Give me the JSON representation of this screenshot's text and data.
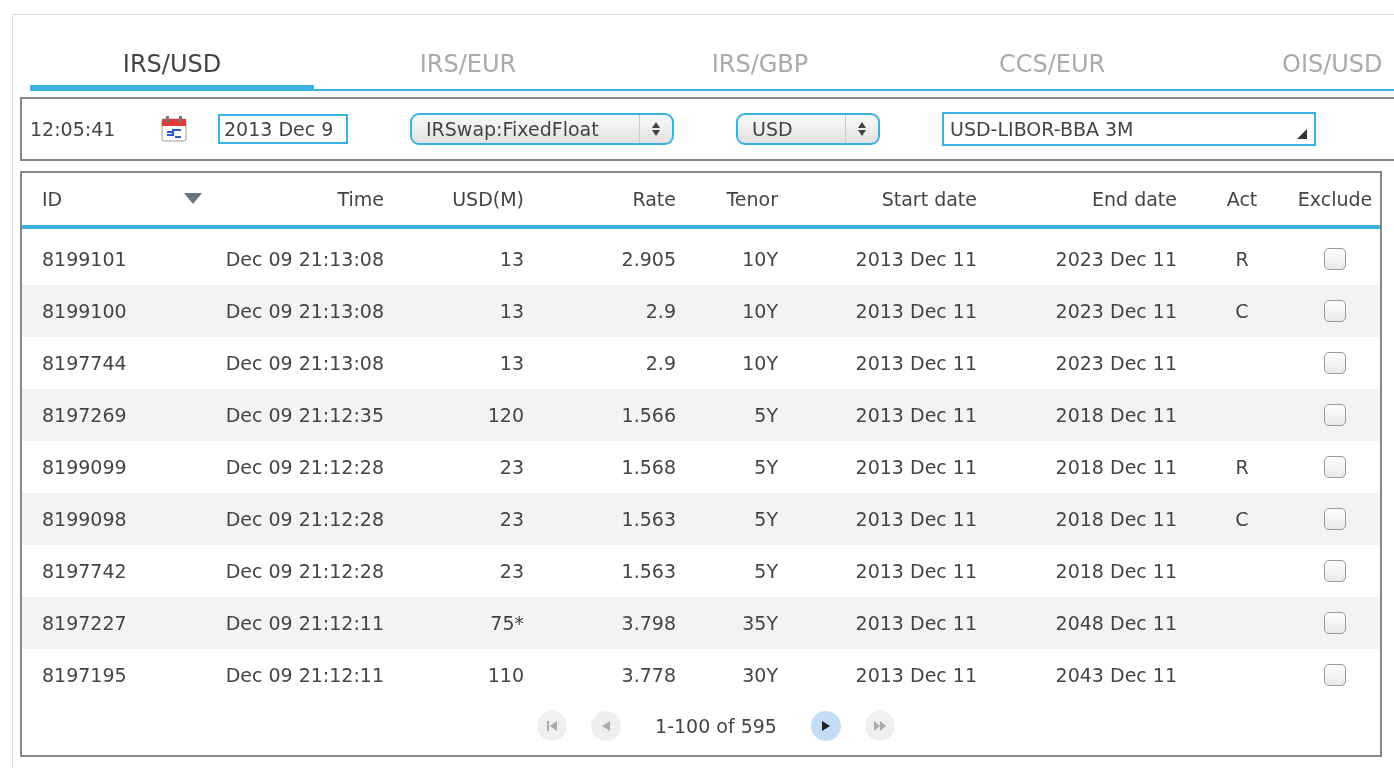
{
  "tabs": [
    {
      "label": "IRS/USD",
      "selected": true
    },
    {
      "label": "IRS/EUR",
      "selected": false
    },
    {
      "label": "IRS/GBP",
      "selected": false
    },
    {
      "label": "CCS/EUR",
      "selected": false
    },
    {
      "label": "OIS/USD",
      "selected": false
    }
  ],
  "filters": {
    "time": "12:05:41",
    "date": "2013 Dec 9",
    "product": "IRSwap:FixedFloat",
    "currency": "USD",
    "index": "USD-LIBOR-BBA 3M"
  },
  "table": {
    "columns": [
      {
        "label": "ID",
        "sorted_descending": true
      },
      {
        "label": "Time"
      },
      {
        "label": "USD(M)"
      },
      {
        "label": "Rate"
      },
      {
        "label": "Tenor"
      },
      {
        "label": "Start date"
      },
      {
        "label": "End date"
      },
      {
        "label": "Act"
      },
      {
        "label": "Exclude"
      }
    ],
    "rows": [
      {
        "id": "8199101",
        "time": "Dec 09 21:13:08",
        "amount": "13",
        "rate": "2.905",
        "tenor": "10Y",
        "start": "2013 Dec 11",
        "end": "2023 Dec 11",
        "act": "R",
        "exclude": false
      },
      {
        "id": "8199100",
        "time": "Dec 09 21:13:08",
        "amount": "13",
        "rate": "2.9",
        "tenor": "10Y",
        "start": "2013 Dec 11",
        "end": "2023 Dec 11",
        "act": "C",
        "exclude": false
      },
      {
        "id": "8197744",
        "time": "Dec 09 21:13:08",
        "amount": "13",
        "rate": "2.9",
        "tenor": "10Y",
        "start": "2013 Dec 11",
        "end": "2023 Dec 11",
        "exclude": false
      },
      {
        "id": "8197269",
        "time": "Dec 09 21:12:35",
        "amount": "120",
        "rate": "1.566",
        "tenor": "5Y",
        "start": "2013 Dec 11",
        "end": "2018 Dec 11",
        "exclude": false
      },
      {
        "id": "8199099",
        "time": "Dec 09 21:12:28",
        "amount": "23",
        "rate": "1.568",
        "tenor": "5Y",
        "start": "2013 Dec 11",
        "end": "2018 Dec 11",
        "act": "R",
        "exclude": false
      },
      {
        "id": "8199098",
        "time": "Dec 09 21:12:28",
        "amount": "23",
        "rate": "1.563",
        "tenor": "5Y",
        "start": "2013 Dec 11",
        "end": "2018 Dec 11",
        "act": "C",
        "exclude": false
      },
      {
        "id": "8197742",
        "time": "Dec 09 21:12:28",
        "amount": "23",
        "rate": "1.563",
        "tenor": "5Y",
        "start": "2013 Dec 11",
        "end": "2018 Dec 11",
        "exclude": false
      },
      {
        "id": "8197227",
        "time": "Dec 09 21:12:11",
        "amount": "75*",
        "rate": "3.798",
        "tenor": "35Y",
        "start": "2013 Dec 11",
        "end": "2048 Dec 11",
        "exclude": false
      },
      {
        "id": "8197195",
        "time": "Dec 09 21:12:11",
        "amount": "110",
        "rate": "3.778",
        "tenor": "30Y",
        "start": "2013 Dec 11",
        "end": "2043 Dec 11",
        "exclude": false
      }
    ]
  },
  "pager": {
    "range": "1-100 of 595",
    "buttons": [
      {
        "kind": "first",
        "disabled": true
      },
      {
        "kind": "prev",
        "disabled": true
      },
      {
        "kind": "next",
        "disabled": false
      },
      {
        "kind": "last",
        "disabled": true
      }
    ]
  }
}
